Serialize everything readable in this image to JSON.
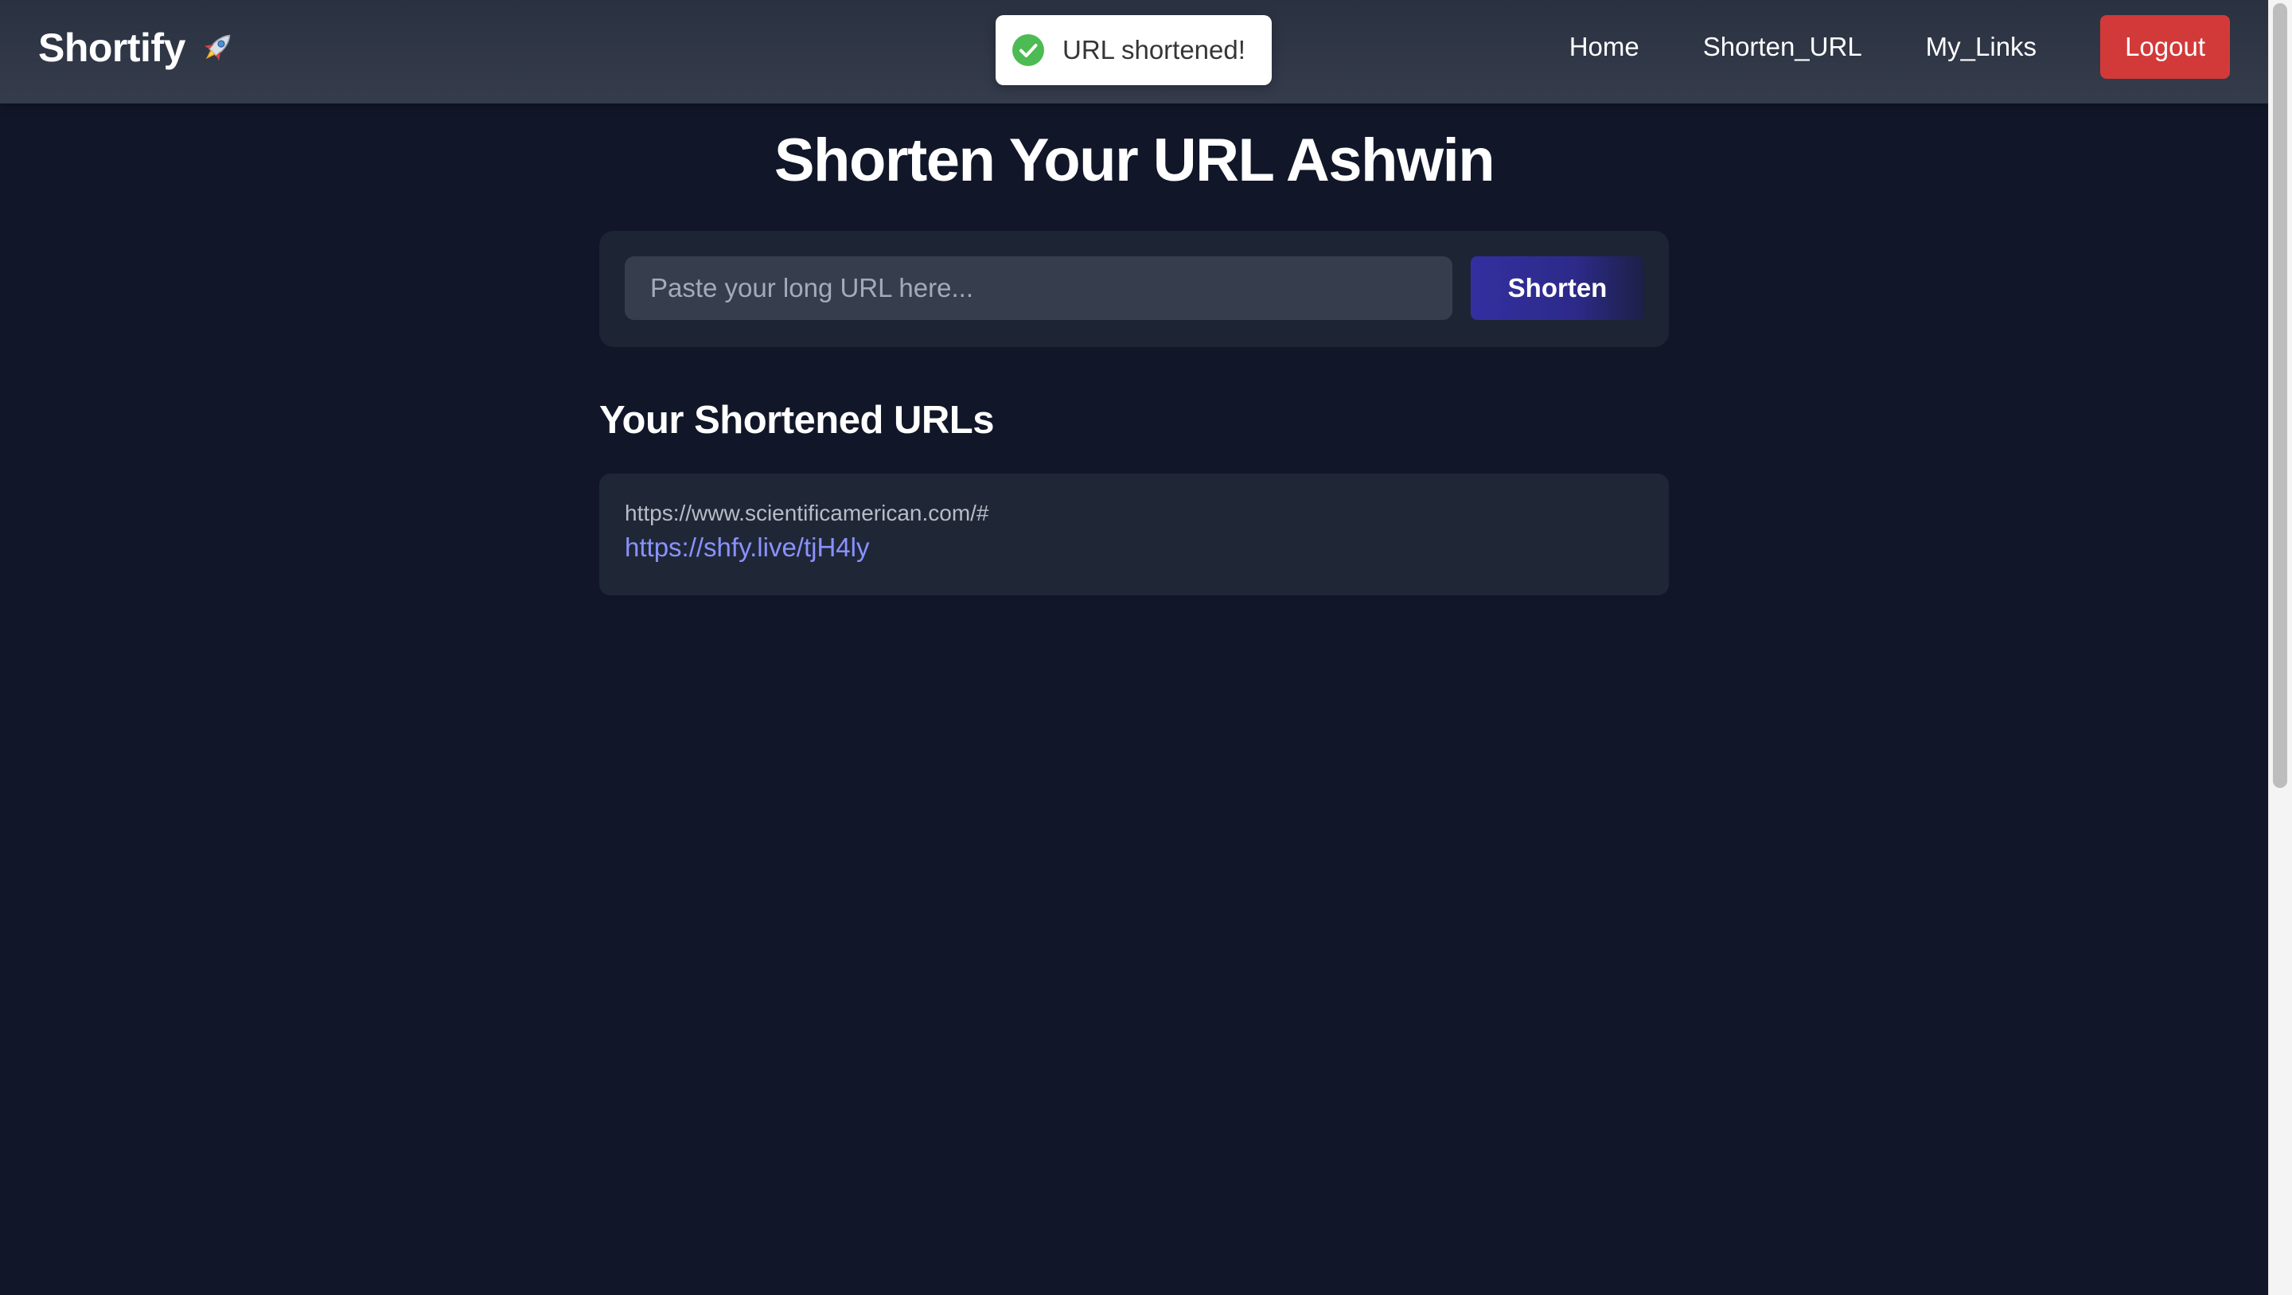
{
  "nav": {
    "brand": "Shortify",
    "brand_icon": "rocket-icon",
    "links": [
      "Home",
      "Shorten_URL",
      "My_Links"
    ],
    "logout_label": "Logout",
    "logout_color": "#d23a3a"
  },
  "toast": {
    "icon": "check-circle-icon",
    "message": "URL shortened!",
    "icon_color": "#4cbb53"
  },
  "main": {
    "title": "Shorten Your URL Ashwin",
    "input_placeholder": "Paste your long URL here...",
    "input_value": "",
    "shorten_label": "Shorten",
    "section_title": "Your Shortened URLs",
    "urls": [
      {
        "original": "https://www.scientificamerican.com/#",
        "short": "https://shfy.live/tjH4ly"
      }
    ]
  },
  "colors": {
    "background": "#111729",
    "card": "#1d2434",
    "accent_link": "#8a92ff",
    "button_primary": "#332fa0"
  }
}
